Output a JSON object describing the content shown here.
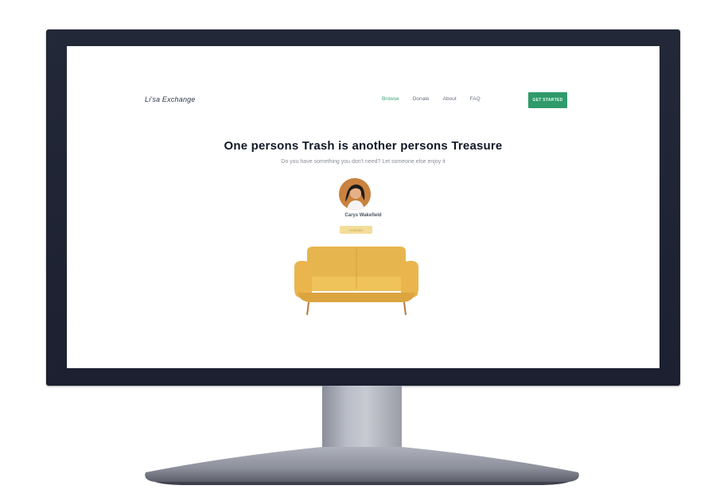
{
  "site": {
    "logo_text": "Li'sa Exchange",
    "nav_links": [
      "Browse",
      "Donate",
      "About",
      "FAQ"
    ],
    "cta_label": "GET STARTED",
    "headline": "One persons Trash is another persons Treasure",
    "subheadline": "Do you have something you don't need? Let someone else enjoy it",
    "username": "Carys Wakefield",
    "tag_label": "Available",
    "item_image": "yellow-sofa"
  },
  "colors": {
    "accent": "#2f9a6a",
    "tag_bg": "#f3dd9a",
    "sofa": "#e7b54e"
  }
}
